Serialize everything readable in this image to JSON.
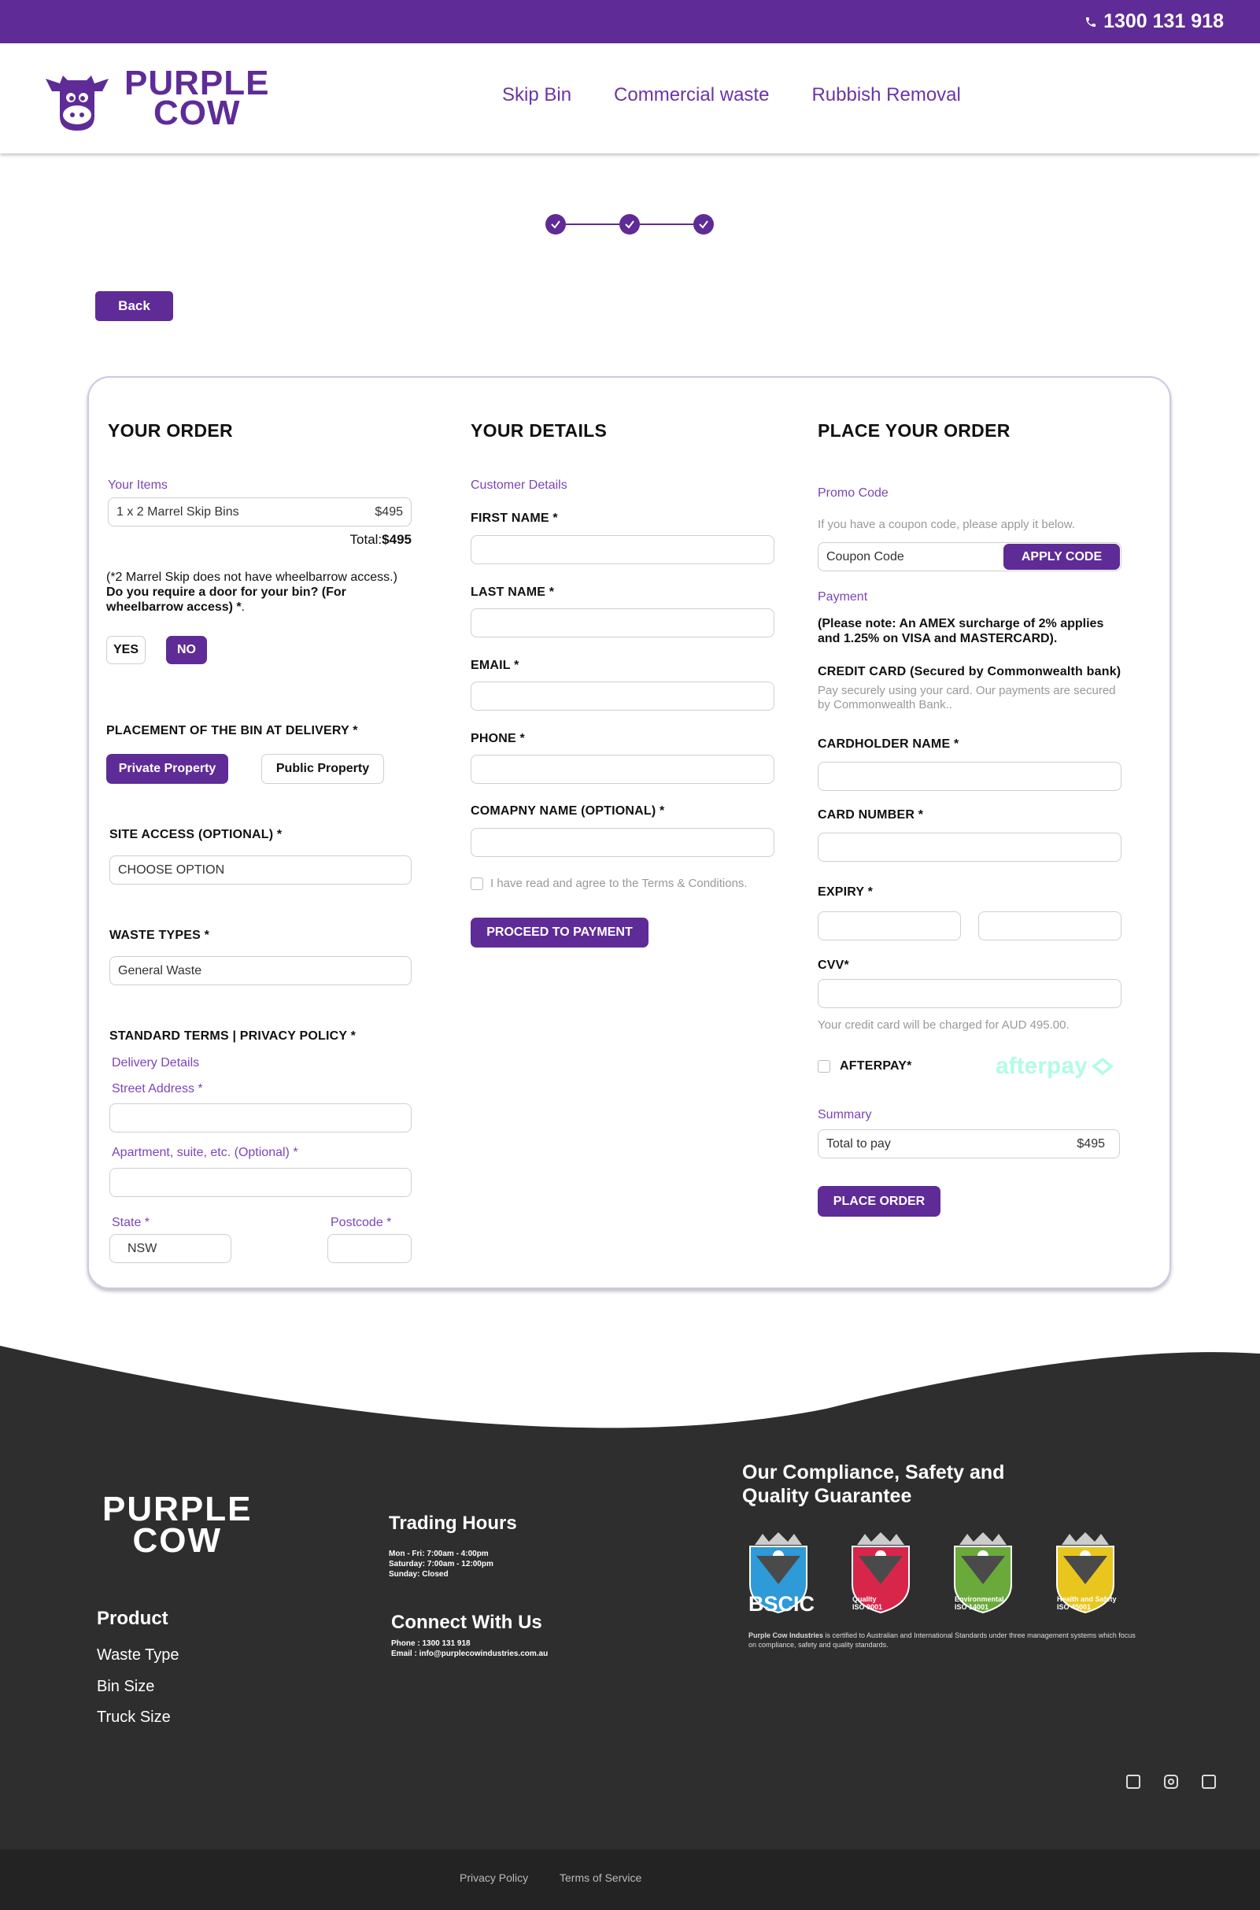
{
  "topbar": {
    "phone": "1300 131 918"
  },
  "header": {
    "logo_line1": "PURPLE",
    "logo_line2": "COW",
    "nav": [
      "Skip Bin",
      "Commercial waste",
      "Rubbish Removal"
    ]
  },
  "back_label": "Back",
  "order": {
    "title": "YOUR ORDER",
    "items_label": "Your Items",
    "item_name": "1 x 2 Marrel Skip Bins",
    "item_price": "$495",
    "total_label": "Total:",
    "total_value": "$495",
    "note": "(*2 Marrel Skip does not have wheelbarrow access.)",
    "door_question": "Do you require a door for your bin? (For wheelbarrow access) *",
    "door_question_end": ".",
    "yes": "YES",
    "no": "NO",
    "placement_label": "PLACEMENT OF THE BIN AT DELIVERY *",
    "private": "Private Property",
    "public": "Public Property",
    "site_access_label": "SITE ACCESS (OPTIONAL) *",
    "site_access_value": "CHOOSE OPTION",
    "waste_label": "WASTE TYPES *",
    "waste_value": "General Waste",
    "terms_label": "STANDARD TERMS | PRIVACY POLICY *",
    "delivery_label": "Delivery Details",
    "street_label": "Street Address *",
    "apartment_label": "Apartment, suite, etc. (Optional) *",
    "state_label": "State *",
    "state_value": "NSW",
    "postcode_label": "Postcode *"
  },
  "details": {
    "title": "YOUR DETAILS",
    "customer_label": "Customer Details",
    "first_name": "FIRST NAME *",
    "last_name": "LAST NAME *",
    "email": "EMAIL *",
    "phone": "PHONE *",
    "company": "COMAPNY NAME (OPTIONAL) *",
    "agree": "I have read and agree to the Terms & Conditions.",
    "proceed": "PROCEED TO PAYMENT"
  },
  "place": {
    "title": "PLACE YOUR ORDER",
    "promo_label": "Promo Code",
    "promo_hint": "If you have a coupon code, please apply it below.",
    "coupon_value": "Coupon Code",
    "apply": "APPLY CODE",
    "payment_label": "Payment",
    "surcharge_note": "(Please note: An AMEX surcharge of 2% applies and 1.25% on VISA and MASTERCARD).",
    "credit_title": "CREDIT CARD (Secured by Commonwealth bank)",
    "credit_hint": "Pay securely using your card. Our payments are secured by Commonwealth Bank..",
    "cardholder": "CARDHOLDER NAME *",
    "card_number": "CARD NUMBER *",
    "expiry": "EXPIRY *",
    "cvv": "CVV*",
    "charge_note": "Your credit card will be charged for AUD 495.00.",
    "afterpay_label": "AFTERPAY*",
    "afterpay_logo": "afterpay",
    "summary_label": "Summary",
    "total_to_pay": "Total to pay",
    "total_amount": "$495",
    "place_order": "PLACE ORDER"
  },
  "footer": {
    "logo_line1": "PURPLE",
    "logo_line2": "COW",
    "product_title": "Product",
    "product_links": [
      "Waste Type",
      "Bin Size",
      "Truck Size"
    ],
    "hours_title": "Trading Hours",
    "hours": [
      "Mon - Fri: 7:00am - 4:00pm",
      "Saturday: 7:00am - 12:00pm",
      "Sunday: Closed"
    ],
    "connect_title": "Connect With Us",
    "connect_phone": "Phone : 1300 131 918",
    "connect_email": "Email : info@purplecowindustries.com.au",
    "compliance_title_1": "Our Compliance, Safety and",
    "compliance_title_2": "Quality Guarantee",
    "badges": [
      {
        "name": "BSCIC",
        "sub": "",
        "color": "#2e9ad8"
      },
      {
        "name": "Quality",
        "sub": "ISO 9001",
        "color": "#d8264a"
      },
      {
        "name": "Environmental",
        "sub": "ISO 14001",
        "color": "#6aaa3a"
      },
      {
        "name": "Health and Safety",
        "sub": "ISO 45001",
        "color": "#e8c61e"
      }
    ],
    "compliance_company": "Purple Cow Industries",
    "compliance_text": " is certified to Australian and International Standards under three management systems which focus on compliance, safety and quality standards.",
    "privacy": "Privacy Policy",
    "terms": "Terms of Service"
  },
  "colors": {
    "brand": "#5e2b97",
    "footer": "#2e2e2e",
    "afterpay": "#b2fce4"
  }
}
